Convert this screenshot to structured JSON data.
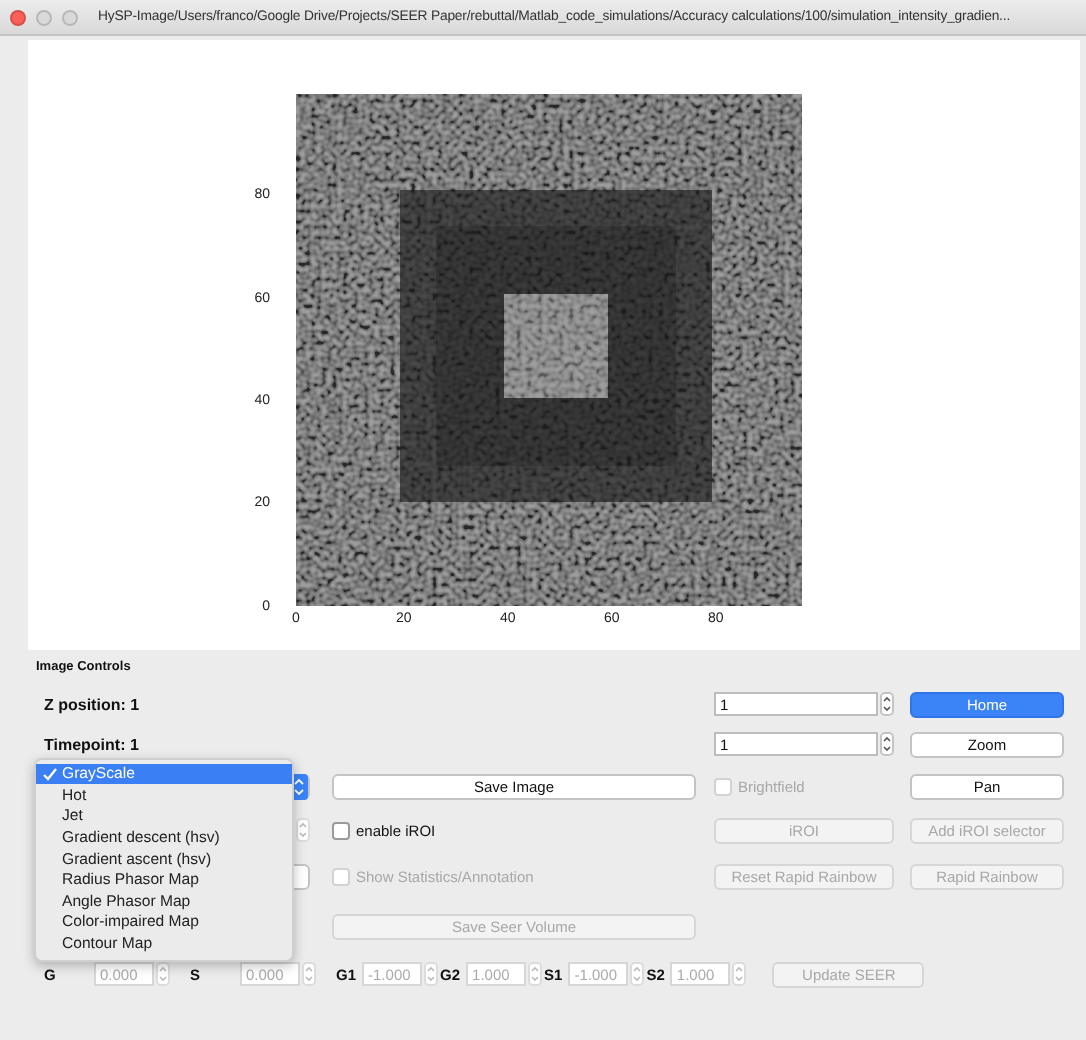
{
  "window": {
    "title": "HySP-Image/Users/franco/Google Drive/Projects/SEER Paper/rebuttal/Matlab_code_simulations/Accuracy calculations/100/simulation_intensity_gradien..."
  },
  "plot": {
    "x_ticks": [
      "0",
      "20",
      "40",
      "60",
      "80"
    ],
    "y_ticks": [
      "80",
      "60",
      "40",
      "20",
      "0"
    ]
  },
  "image_controls": {
    "title": "Image Controls",
    "z_position": {
      "label": "Z position: 1",
      "value": "1"
    },
    "timepoint": {
      "label": "Timepoint: 1",
      "value": "1"
    },
    "home_button": {
      "label": "Home",
      "default": true,
      "disabled": false
    },
    "zoom_button": {
      "label": "Zoom",
      "default": false,
      "disabled": false
    },
    "colormap": {
      "open": true,
      "options": [
        {
          "label": "GrayScale",
          "selected": true
        },
        {
          "label": "Hot",
          "selected": false
        },
        {
          "label": "Jet",
          "selected": false
        },
        {
          "label": "Gradient descent (hsv)",
          "selected": false
        },
        {
          "label": "Gradient ascent (hsv)",
          "selected": false
        },
        {
          "label": "Radius Phasor Map",
          "selected": false
        },
        {
          "label": "Angle Phasor Map",
          "selected": false
        },
        {
          "label": "Color-impaired Map",
          "selected": false
        },
        {
          "label": "Contour Map",
          "selected": false
        }
      ]
    },
    "save_image_button": {
      "label": "Save Image",
      "default": false,
      "disabled": false
    },
    "brightfield": {
      "label": "Brightfield",
      "checked": false,
      "disabled": true
    },
    "pan_button": {
      "label": "Pan",
      "default": false,
      "disabled": false
    },
    "enable_iroi": {
      "label": "enable iROI",
      "checked": false,
      "disabled": false
    },
    "iroi_button": {
      "label": "iROI",
      "disabled": true
    },
    "add_iroi_selector_button": {
      "label": "Add iROI selector",
      "disabled": true
    },
    "show_statistics": {
      "label": "Show Statistics/Annotation",
      "checked": false,
      "disabled": true
    },
    "reset_rapid_rainbow_button": {
      "label": "Reset Rapid Rainbow",
      "disabled": true
    },
    "rapid_rainbow_button": {
      "label": "Rapid Rainbow",
      "disabled": true
    },
    "save_seer_volume_button": {
      "label": "Save Seer Volume",
      "disabled": true
    },
    "phasor_fields": [
      {
        "label": "G",
        "value": "0.000",
        "disabled": true,
        "kind": "wide"
      },
      {
        "label": "S",
        "value": "0.000",
        "disabled": true,
        "kind": "wide"
      },
      {
        "label": "G1",
        "value": "-1.000",
        "disabled": true,
        "kind": "compact"
      },
      {
        "label": "G2",
        "value": "1.000",
        "disabled": true,
        "kind": "compact"
      },
      {
        "label": "S1",
        "value": "-1.000",
        "disabled": true,
        "kind": "compact"
      },
      {
        "label": "S2",
        "value": "1.000",
        "disabled": true,
        "kind": "compact"
      }
    ],
    "update_seer_button": {
      "label": "Update SEER",
      "disabled": true
    }
  }
}
